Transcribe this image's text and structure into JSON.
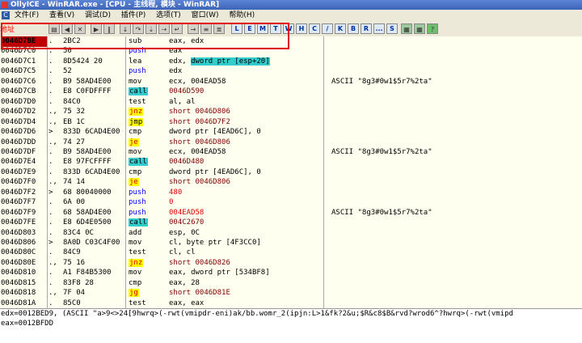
{
  "title": "OllyICE - WinRAR.exe - [CPU - 主线程, 模块 - WinRAR]",
  "menu": [
    "文件(F)",
    "查看(V)",
    "调试(D)",
    "插件(P)",
    "选项(T)",
    "窗口(W)",
    "帮助(H)"
  ],
  "toolbar_letters": [
    "L",
    "E",
    "M",
    "T",
    "W",
    "H",
    "C",
    "/",
    "K",
    "B",
    "R",
    "...",
    "S"
  ],
  "header_label": "地址",
  "rows": [
    {
      "addr": "0046D7BE",
      "mark": ".",
      "hex": "2BC2",
      "mn": "sub",
      "op": "eax, edx",
      "cm": "",
      "mnc": "",
      "opc": "",
      "sel": true
    },
    {
      "addr": "0046D7C0",
      "mark": ".",
      "hex": "50",
      "mn": "push",
      "op": "eax",
      "cm": "",
      "mnc": "mn-push",
      "opc": ""
    },
    {
      "addr": "0046D7C1",
      "mark": ".",
      "hex": "8D5424 20",
      "mn": "lea",
      "op": "edx, dword ptr [esp+20]",
      "cm": "",
      "mnc": "",
      "opc": "mem"
    },
    {
      "addr": "0046D7C5",
      "mark": ".",
      "hex": "52",
      "mn": "push",
      "op": "edx",
      "cm": "",
      "mnc": "mn-push",
      "opc": ""
    },
    {
      "addr": "0046D7C6",
      "mark": ".",
      "hex": "B9 58AD4E00",
      "mn": "mov",
      "op": "ecx, 004EAD58",
      "cm": "ASCII \"8g3#0w1$5r7%2ta\"",
      "mnc": "",
      "opc": ""
    },
    {
      "addr": "0046D7CB",
      "mark": ".",
      "hex": "E8 C0FDFFFF",
      "mn": "call",
      "op": "0046D590",
      "cm": "",
      "mnc": "call",
      "opc": "op-dark"
    },
    {
      "addr": "0046D7D0",
      "mark": ".",
      "hex": "84C0",
      "mn": "test",
      "op": "al, al",
      "cm": "",
      "mnc": "",
      "opc": ""
    },
    {
      "addr": "0046D7D2",
      "mark": ".,",
      "hex": "75 32",
      "mn": "jnz",
      "op": "short 0046D806",
      "cm": "",
      "mnc": "jcc",
      "opc": "op-dark"
    },
    {
      "addr": "0046D7D4",
      "mark": ".,",
      "hex": "EB 1C",
      "mn": "jmp",
      "op": "short 0046D7F2",
      "cm": "",
      "mnc": "jmp",
      "opc": "op-dark"
    },
    {
      "addr": "0046D7D6",
      "mark": ">",
      "hex": "833D 6CAD4E00",
      "mn": "cmp",
      "op": "dword ptr [4EAD6C], 0",
      "cm": "",
      "mnc": "",
      "opc": ""
    },
    {
      "addr": "0046D7DD",
      "mark": ".,",
      "hex": "74 27",
      "mn": "je",
      "op": "short 0046D806",
      "cm": "",
      "mnc": "jcc",
      "opc": "op-dark"
    },
    {
      "addr": "0046D7DF",
      "mark": ".",
      "hex": "B9 58AD4E00",
      "mn": "mov",
      "op": "ecx, 004EAD58",
      "cm": "ASCII \"8g3#0w1$5r7%2ta\"",
      "mnc": "",
      "opc": ""
    },
    {
      "addr": "0046D7E4",
      "mark": ".",
      "hex": "E8 97FCFFFF",
      "mn": "call",
      "op": "0046D480",
      "cm": "",
      "mnc": "call",
      "opc": "op-dark"
    },
    {
      "addr": "0046D7E9",
      "mark": ".",
      "hex": "833D 6CAD4E00",
      "mn": "cmp",
      "op": "dword ptr [4EAD6C], 0",
      "cm": "",
      "mnc": "",
      "opc": ""
    },
    {
      "addr": "0046D7F0",
      "mark": ".,",
      "hex": "74 14",
      "mn": "je",
      "op": "short 0046D806",
      "cm": "",
      "mnc": "jcc",
      "opc": "op-dark"
    },
    {
      "addr": "0046D7F2",
      "mark": ">",
      "hex": "68 80040000",
      "mn": "push",
      "op": "480",
      "cm": "",
      "mnc": "mn-push",
      "opc": "op-red"
    },
    {
      "addr": "0046D7F7",
      "mark": ".",
      "hex": "6A 00",
      "mn": "push",
      "op": "0",
      "cm": "",
      "mnc": "mn-push",
      "opc": "op-red"
    },
    {
      "addr": "0046D7F9",
      "mark": ".",
      "hex": "68 58AD4E00",
      "mn": "push",
      "op": "004EAD58",
      "cm": "ASCII \"8g3#0w1$5r7%2ta\"",
      "mnc": "mn-push",
      "opc": "op-red"
    },
    {
      "addr": "0046D7FE",
      "mark": ".",
      "hex": "E8 6D4E0500",
      "mn": "call",
      "op": "004C2670",
      "cm": "",
      "mnc": "call",
      "opc": "op-dark"
    },
    {
      "addr": "0046D803",
      "mark": ".",
      "hex": "83C4 0C",
      "mn": "add",
      "op": "esp, 0C",
      "cm": "",
      "mnc": "",
      "opc": ""
    },
    {
      "addr": "0046D806",
      "mark": ">",
      "hex": "8A0D C03C4F00",
      "mn": "mov",
      "op": "cl, byte ptr [4F3CC0]",
      "cm": "",
      "mnc": "",
      "opc": ""
    },
    {
      "addr": "0046D80C",
      "mark": ".",
      "hex": "84C9",
      "mn": "test",
      "op": "cl, cl",
      "cm": "",
      "mnc": "",
      "opc": ""
    },
    {
      "addr": "0046D80E",
      "mark": ".,",
      "hex": "75 16",
      "mn": "jnz",
      "op": "short 0046D826",
      "cm": "",
      "mnc": "jcc",
      "opc": "op-dark"
    },
    {
      "addr": "0046D810",
      "mark": ".",
      "hex": "A1 F84B5300",
      "mn": "mov",
      "op": "eax, dword ptr [534BF8]",
      "cm": "",
      "mnc": "",
      "opc": ""
    },
    {
      "addr": "0046D815",
      "mark": ".",
      "hex": "83F8 28",
      "mn": "cmp",
      "op": "eax, 28",
      "cm": "",
      "mnc": "",
      "opc": ""
    },
    {
      "addr": "0046D818",
      "mark": ".,",
      "hex": "7F 04",
      "mn": "jg",
      "op": "short 0046D81E",
      "cm": "",
      "mnc": "jcc",
      "opc": "op-dark"
    },
    {
      "addr": "0046D81A",
      "mark": ".",
      "hex": "85C0",
      "mn": "test",
      "op": "eax, eax",
      "cm": "",
      "mnc": "",
      "opc": ""
    }
  ],
  "info_lines": [
    "edx=0012BED9, (ASCII \"a>9<>24[9hwrq>(-rwt(vmipdr-eni)ak/bb.womr_2(ipjn:L>1&fk?2&u;$R&c8$B&rvd?wrod6^?hwrq>(-rwt(vmipd",
    "eax=0012BFDD"
  ]
}
